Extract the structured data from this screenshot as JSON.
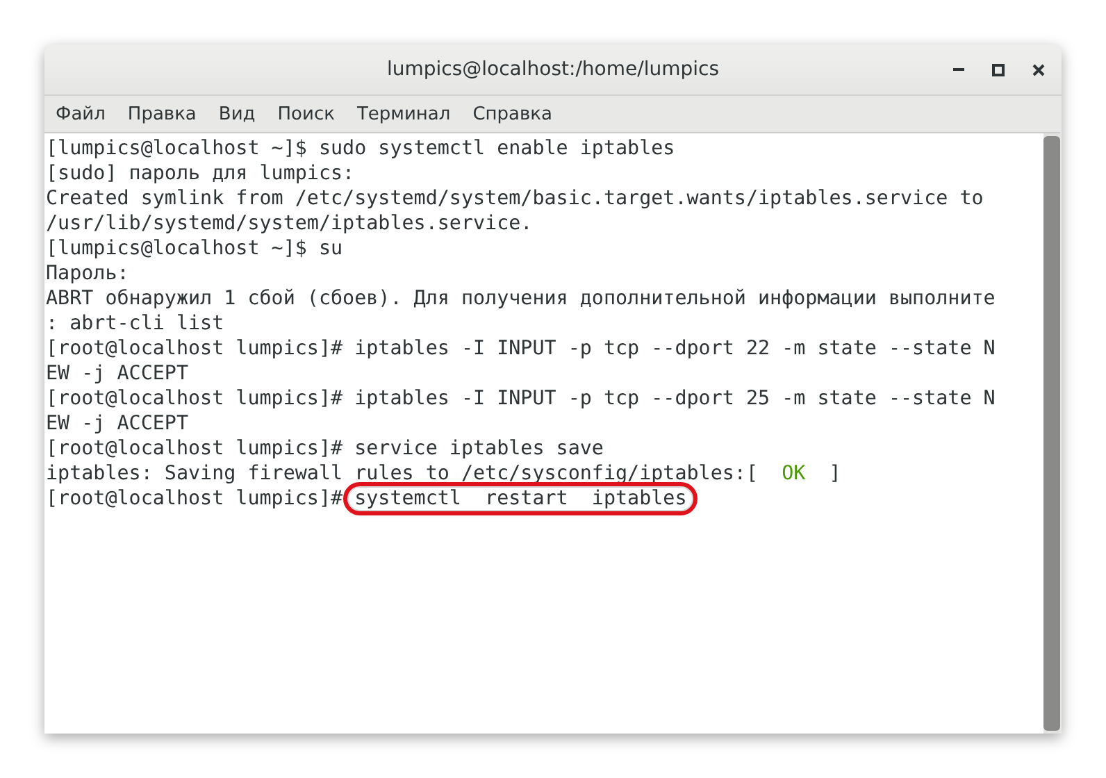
{
  "window": {
    "title": "lumpics@localhost:/home/lumpics"
  },
  "menu": [
    "Файл",
    "Правка",
    "Вид",
    "Поиск",
    "Терминал",
    "Справка"
  ],
  "terminal": {
    "lines": [
      [
        {
          "kind": "plain",
          "text": "[lumpics@localhost ~]$ sudo systemctl enable iptables"
        }
      ],
      [
        {
          "kind": "plain",
          "text": "[sudo] пароль для lumpics:"
        }
      ],
      [
        {
          "kind": "plain",
          "text": "Created symlink from /etc/systemd/system/basic.target.wants/iptables.service to"
        }
      ],
      [
        {
          "kind": "plain",
          "text": "/usr/lib/systemd/system/iptables.service."
        }
      ],
      [
        {
          "kind": "plain",
          "text": "[lumpics@localhost ~]$ su"
        }
      ],
      [
        {
          "kind": "plain",
          "text": "Пароль:"
        }
      ],
      [
        {
          "kind": "plain",
          "text": "ABRT обнаружил 1 сбой (сбоев). Для получения дополнительной информации выполните"
        }
      ],
      [
        {
          "kind": "plain",
          "text": ": abrt-cli list"
        }
      ],
      [
        {
          "kind": "plain",
          "text": "[root@localhost lumpics]# iptables -I INPUT -p tcp --dport 22 -m state --state N"
        }
      ],
      [
        {
          "kind": "plain",
          "text": "EW -j ACCEPT"
        }
      ],
      [
        {
          "kind": "plain",
          "text": "[root@localhost lumpics]# iptables -I INPUT -p tcp --dport 25 -m state --state N"
        }
      ],
      [
        {
          "kind": "plain",
          "text": "EW -j ACCEPT"
        }
      ],
      [
        {
          "kind": "plain",
          "text": "[root@localhost lumpics]# service iptables save"
        }
      ],
      [
        {
          "kind": "plain",
          "text": "iptables: Saving firewall rules to /etc/sysconfig/iptables:[  "
        },
        {
          "kind": "ok",
          "text": "OK"
        },
        {
          "kind": "plain",
          "text": "  ]"
        }
      ],
      [
        {
          "kind": "plain",
          "text": "[root@localhost lumpics]# "
        },
        {
          "kind": "circled",
          "text": "systemctl  restart  iptables"
        }
      ]
    ]
  }
}
